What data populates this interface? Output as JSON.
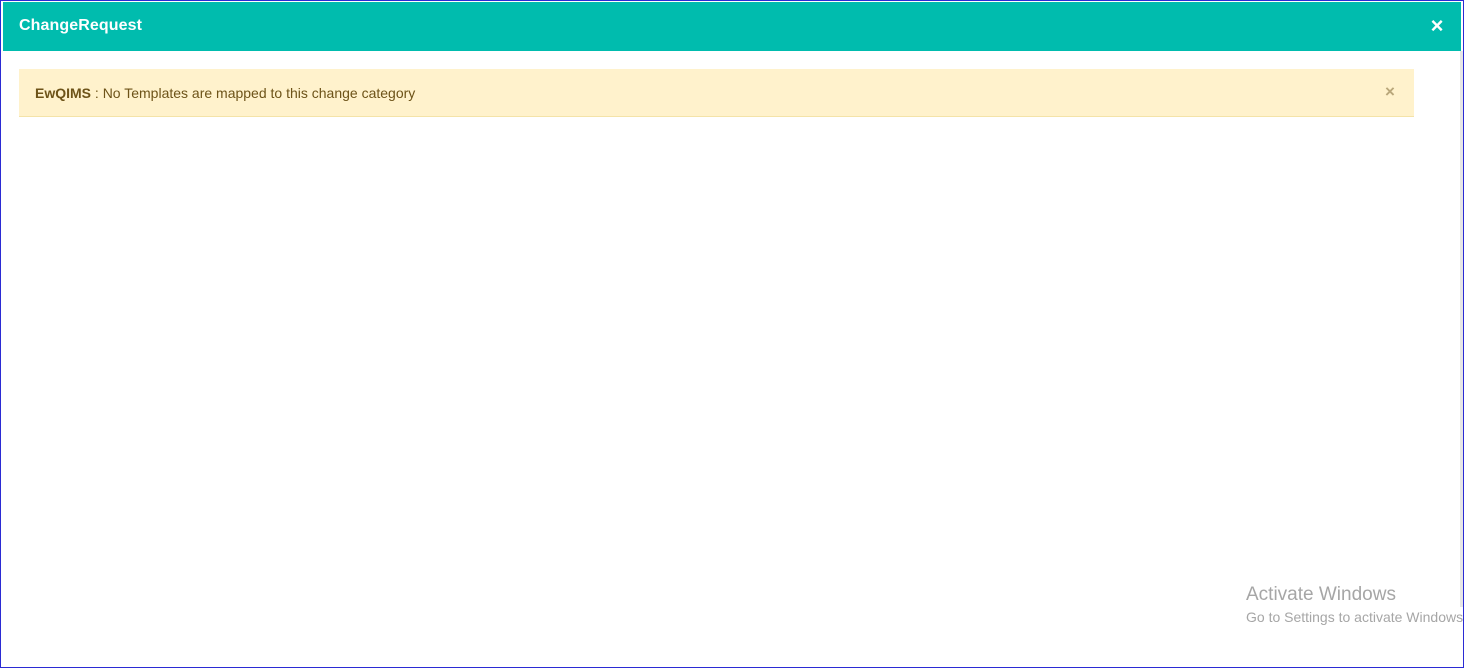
{
  "window": {
    "title": "ChangeRequest",
    "close_symbol": "×",
    "close_icon": "close-icon",
    "header_color": "#00bcae"
  },
  "alert": {
    "label": "EwQIMS",
    "separator": " : ",
    "message": "No Templates are mapped to this change category",
    "close_symbol": "×",
    "close_icon": "close-icon",
    "background_color": "#fff2cc",
    "text_color": "#6d5318"
  },
  "watermark": {
    "title": "Activate Windows",
    "subtitle": "Go to Settings to activate Windows."
  }
}
